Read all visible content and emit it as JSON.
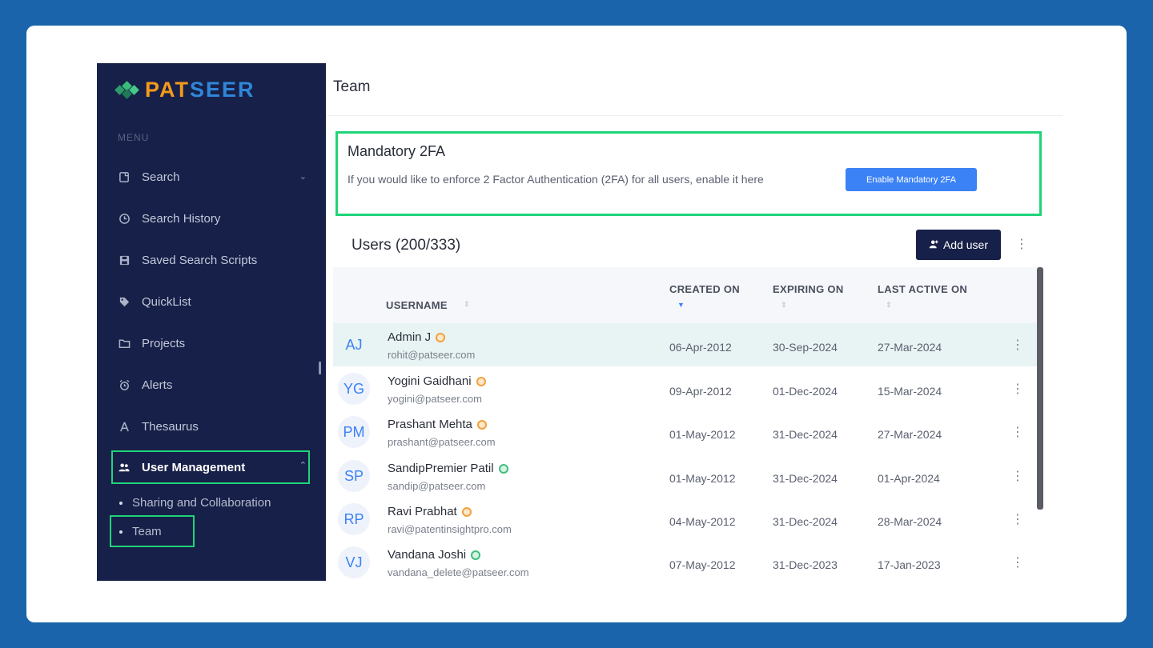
{
  "brand": {
    "logo_part1": "PAT",
    "logo_part2": "SEER"
  },
  "sidebar": {
    "menu_label": "MENU",
    "items": [
      {
        "label": "Search",
        "icon": "search-icon"
      },
      {
        "label": "Search History",
        "icon": "history-icon"
      },
      {
        "label": "Saved Search Scripts",
        "icon": "save-icon"
      },
      {
        "label": "QuickList",
        "icon": "tag-icon"
      },
      {
        "label": "Projects",
        "icon": "folder-icon"
      },
      {
        "label": "Alerts",
        "icon": "alarm-icon"
      },
      {
        "label": "Thesaurus",
        "icon": "thesaurus-icon"
      },
      {
        "label": "User Management",
        "icon": "users-icon"
      }
    ],
    "sub_items": [
      {
        "label": "Sharing and Collaboration"
      },
      {
        "label": "Team"
      }
    ]
  },
  "header": {
    "title": "Team"
  },
  "twofa": {
    "title": "Mandatory 2FA",
    "description": "If you would like to enforce 2 Factor Authentication (2FA) for all users, enable it here",
    "button_label": "Enable Mandatory 2FA"
  },
  "users": {
    "title": "Users (200/333)",
    "add_label": "Add user",
    "columns": [
      "USERNAME",
      "CREATED ON",
      "EXPIRING ON",
      "LAST ACTIVE ON"
    ],
    "rows": [
      {
        "initials": "AJ",
        "name": "Admin J",
        "email": "rohit@patseer.com",
        "created": "06-Apr-2012",
        "expiring": "30-Sep-2024",
        "last_active": "27-Mar-2024",
        "badge": "orange"
      },
      {
        "initials": "YG",
        "name": "Yogini Gaidhani",
        "email": "yogini@patseer.com",
        "created": "09-Apr-2012",
        "expiring": "01-Dec-2024",
        "last_active": "15-Mar-2024",
        "badge": "orange"
      },
      {
        "initials": "PM",
        "name": "Prashant Mehta",
        "email": "prashant@patseer.com",
        "created": "01-May-2012",
        "expiring": "31-Dec-2024",
        "last_active": "27-Mar-2024",
        "badge": "orange"
      },
      {
        "initials": "SP",
        "name": "SandipPremier Patil",
        "email": "sandip@patseer.com",
        "created": "01-May-2012",
        "expiring": "31-Dec-2024",
        "last_active": "01-Apr-2024",
        "badge": "green"
      },
      {
        "initials": "RP",
        "name": "Ravi Prabhat",
        "email": "ravi@patentinsightpro.com",
        "created": "04-May-2012",
        "expiring": "31-Dec-2024",
        "last_active": "28-Mar-2024",
        "badge": "orange"
      },
      {
        "initials": "VJ",
        "name": "Vandana Joshi",
        "email": "vandana_delete@patseer.com",
        "created": "07-May-2012",
        "expiring": "31-Dec-2023",
        "last_active": "17-Jan-2023",
        "badge": "green"
      }
    ]
  },
  "colors": {
    "background": "#1a64ab",
    "sidebar": "#172048",
    "highlight": "#1fd47a",
    "accent": "#3b82f6"
  }
}
